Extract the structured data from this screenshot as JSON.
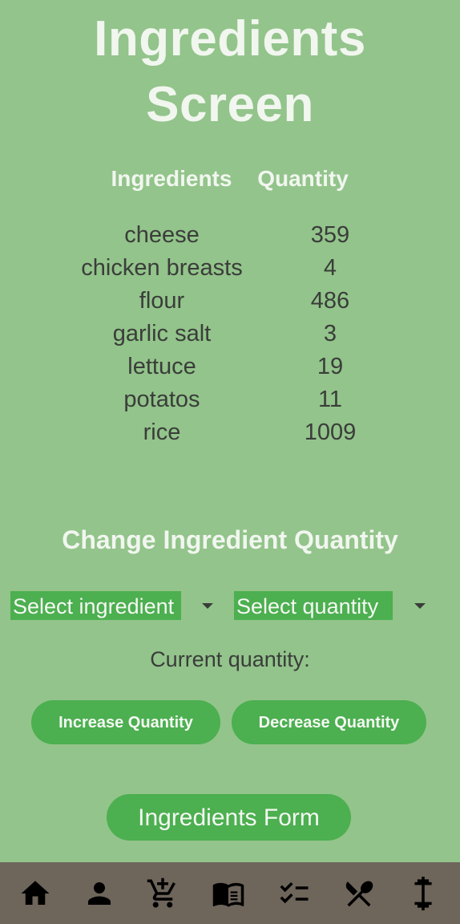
{
  "title": {
    "line1": "Ingredients",
    "line2": "Screen"
  },
  "table": {
    "headers": {
      "ingredient": "Ingredients",
      "quantity": "Quantity"
    },
    "rows": [
      {
        "name": "cheese",
        "qty": "359"
      },
      {
        "name": "chicken breasts",
        "qty": "4"
      },
      {
        "name": "flour",
        "qty": "486"
      },
      {
        "name": "garlic salt",
        "qty": "3"
      },
      {
        "name": "lettuce",
        "qty": "19"
      },
      {
        "name": "potatos",
        "qty": "11"
      },
      {
        "name": "rice",
        "qty": "1009"
      }
    ]
  },
  "change_section": {
    "title": "Change Ingredient Quantity",
    "ingredient_select": {
      "value": "Select ingredient"
    },
    "quantity_select": {
      "value": "Select quantity"
    },
    "current_quantity_label": "Current quantity:",
    "increase_label": "Increase Quantity",
    "decrease_label": "Decrease Quantity"
  },
  "form_button_label": "Ingredients Form",
  "nav": {
    "items": [
      "home-icon",
      "person-icon",
      "add-shopping-cart-icon",
      "menu-book-icon",
      "checklist-icon",
      "restaurant-icon",
      "fitness-icon"
    ]
  },
  "colors": {
    "background": "#93c48b",
    "accent": "#4caf50",
    "nav_bar": "#6e655b",
    "heading_text": "#f1f6ef",
    "body_text": "#3a3d3a"
  }
}
